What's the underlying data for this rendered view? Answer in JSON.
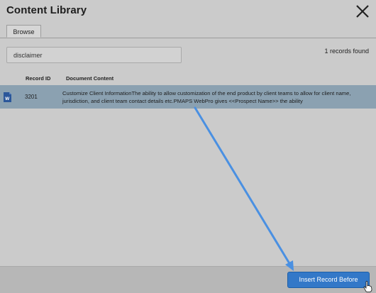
{
  "dialog": {
    "title": "Content Library",
    "close_icon": "close-icon"
  },
  "tabs": [
    {
      "label": "Browse",
      "active": true
    }
  ],
  "search": {
    "value": "disclaimer",
    "placeholder": ""
  },
  "results": {
    "count_text": "1 records found"
  },
  "table": {
    "columns": [
      "Record ID",
      "Document Content"
    ],
    "rows": [
      {
        "icon": "word-document-icon",
        "icon_letter": "W",
        "record_id": "3201",
        "content": "Customize Client InformationThe ability to allow customization of the end product by client teams to allow for client name, jurisdiction, and client team contact details etc.PMAPS WebPro gives <<Prospect Name>> the ability",
        "selected": true
      }
    ]
  },
  "footer": {
    "insert_button_label": "Insert Record Before"
  },
  "colors": {
    "accent": "#3378c8",
    "selected_row": "#8ba1b1",
    "arrow": "#4a90e2"
  }
}
